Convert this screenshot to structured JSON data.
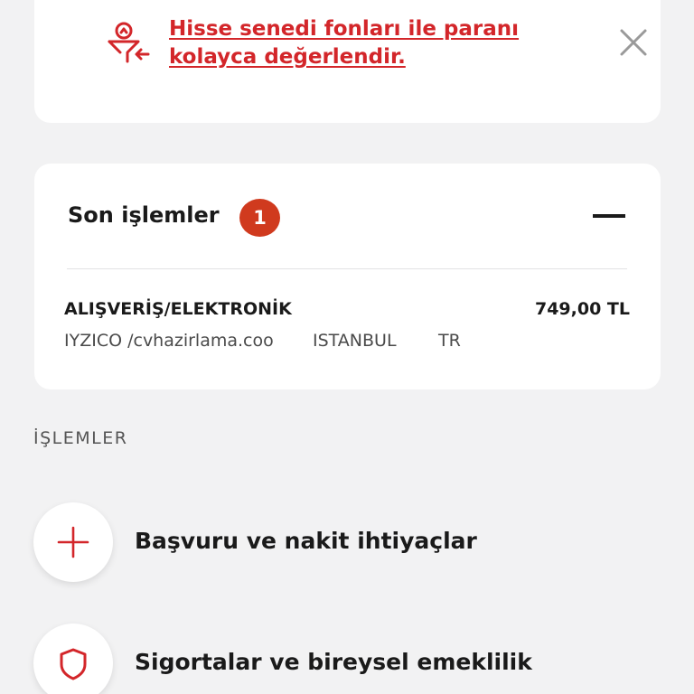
{
  "promo": {
    "text": "Hisse senedi fonları ile paranı kolayca değerlendir.",
    "icon": "fund-growth-icon",
    "close_icon": "close-icon",
    "accent_color": "#d3262a"
  },
  "recent_transactions": {
    "title": "Son işlemler",
    "count": "1",
    "badge_color": "#d03a1e",
    "collapse_icon": "minus-icon",
    "items": [
      {
        "category": "ALIŞVERİŞ/ELEKTRONİK",
        "amount": "749,00 TL",
        "merchant": "IYZICO /cvhazirlama.coo",
        "city": "ISTANBUL",
        "country": "TR"
      }
    ]
  },
  "operations": {
    "section_title": "İŞLEMLER",
    "items": [
      {
        "label": "Başvuru ve nakit ihtiyaçlar",
        "icon": "plus-icon"
      },
      {
        "label": "Sigortalar ve bireysel emeklilik",
        "icon": "shield-icon"
      }
    ]
  }
}
